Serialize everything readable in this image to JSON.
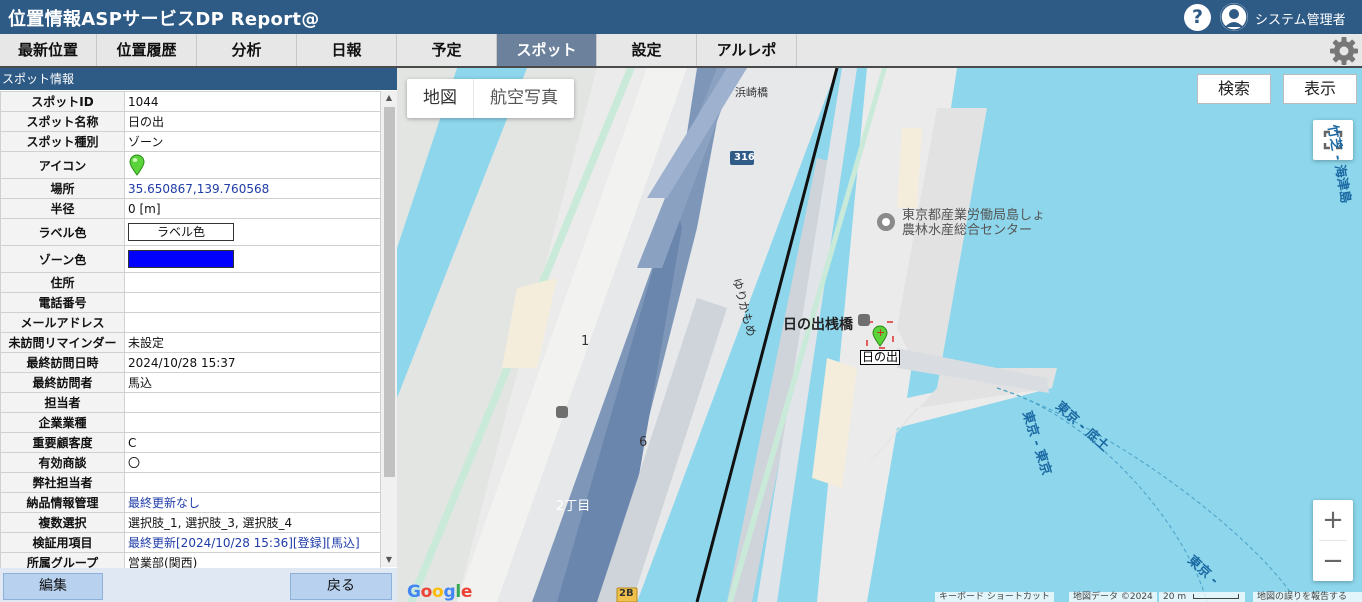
{
  "header": {
    "title": "位置情報ASPサービスDP Report@",
    "user": "システム管理者",
    "help": "?"
  },
  "nav": {
    "tabs": [
      "最新位置",
      "位置履歴",
      "分析",
      "日報",
      "予定",
      "スポット",
      "設定",
      "アルレポ"
    ],
    "active": "スポット"
  },
  "panel": {
    "title": "スポット情報",
    "rows": [
      {
        "label": "スポットID",
        "value": "1044"
      },
      {
        "label": "スポット名称",
        "value": "日の出"
      },
      {
        "label": "スポット種別",
        "value": "ゾーン"
      },
      {
        "label": "アイコン",
        "value": ""
      },
      {
        "label": "場所",
        "value": "35.650867,139.760568"
      },
      {
        "label": "半径",
        "value": "0 [m]"
      },
      {
        "label": "ラベル色",
        "value": "ラベル色"
      },
      {
        "label": "ゾーン色",
        "value": ""
      },
      {
        "label": "住所",
        "value": ""
      },
      {
        "label": "電話番号",
        "value": ""
      },
      {
        "label": "メールアドレス",
        "value": ""
      },
      {
        "label": "未訪問リマインダー",
        "value": "未設定"
      },
      {
        "label": "最終訪問日時",
        "value": "2024/10/28 15:37"
      },
      {
        "label": "最終訪問者",
        "value": "馬込"
      },
      {
        "label": "担当者",
        "value": ""
      },
      {
        "label": "企業業種",
        "value": ""
      },
      {
        "label": "重要顧客度",
        "value": "C"
      },
      {
        "label": "有効商談",
        "value": "〇"
      },
      {
        "label": "弊社担当者",
        "value": ""
      },
      {
        "label": "納品情報管理",
        "value": "最終更新なし"
      },
      {
        "label": "複数選択",
        "value": "選択肢_1, 選択肢_3, 選択肢_4"
      },
      {
        "label": "検証用項目",
        "value": "最終更新[2024/10/28 15:36][登録][馬込]"
      },
      {
        "label": "所属グループ",
        "value": "営業部(関西)"
      }
    ],
    "edit_label": "編集",
    "back_label": "戻る",
    "zone_color": "#0000ff"
  },
  "map": {
    "type_map": "地図",
    "type_satellite": "航空写真",
    "search_label": "検索",
    "display_label": "表示",
    "zoom_in": "+",
    "zoom_out": "−",
    "labels": {
      "hamazaki": "浜崎橋",
      "route316": "316",
      "yurikamome": "ゆりかもめ",
      "poi_line1": "東京都産業労働局島しょ",
      "poi_line2": "農林水産総合センター",
      "bridge": "日の出桟橋",
      "spot": "日の出",
      "num1": "1",
      "num6": "6",
      "chome2": "2丁目",
      "route2b": "2B",
      "ferry1": "東京 - 底土",
      "ferry2": "東京 - 東京",
      "ferry3": "東京 -",
      "ferry4": "竹芝 - 海津島"
    },
    "attribution": {
      "shortcuts": "キーボード ショートカット",
      "data": "地図データ ©2024",
      "scale": "20 m",
      "report": "地図の誤りを報告する"
    },
    "google": "Google"
  }
}
